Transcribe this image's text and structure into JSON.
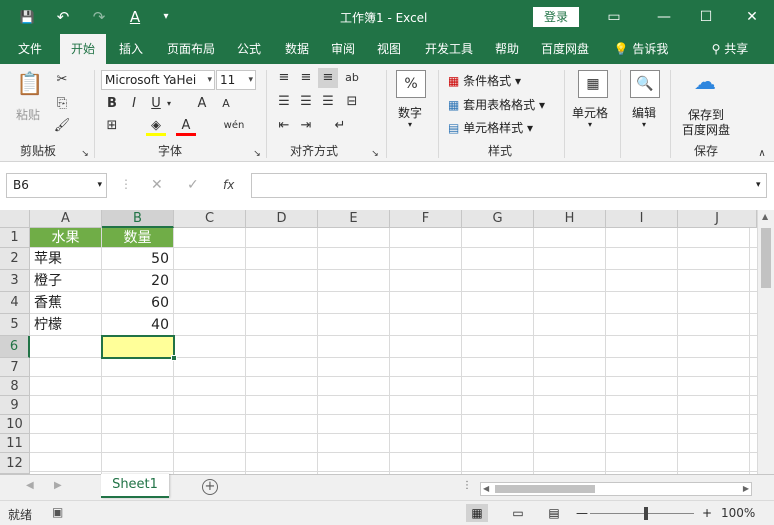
{
  "titlebar": {
    "title": "工作簿1  -  Excel",
    "login": "登录",
    "qat": {
      "save": "💾",
      "undo": "↶",
      "redo": "↷",
      "font_color": "A",
      "customize": "▾"
    },
    "controls": {
      "options": "▭",
      "minimize": "—",
      "maximize": "☐",
      "close": "✕"
    }
  },
  "tabs": [
    "文件",
    "开始",
    "插入",
    "页面布局",
    "公式",
    "数据",
    "审阅",
    "视图",
    "开发工具",
    "帮助",
    "百度网盘"
  ],
  "tell_me": "告诉我",
  "share": "共享",
  "ribbon": {
    "clipboard": {
      "label": "剪贴板",
      "paste": "粘贴"
    },
    "font": {
      "label": "字体",
      "name": "Microsoft YaHei",
      "size": "11",
      "bold": "B",
      "italic": "I",
      "underline": "U",
      "grow": "A",
      "shrink": "A",
      "phonetic": "wén"
    },
    "alignment": {
      "label": "对齐方式"
    },
    "number": {
      "label": "数字",
      "button": "数字",
      "icon": "%"
    },
    "styles": {
      "label": "样式",
      "conditional": "条件格式",
      "table": "套用表格格式",
      "cell": "单元格样式"
    },
    "cells": {
      "button": "单元格"
    },
    "editing": {
      "button": "编辑"
    },
    "save": {
      "label": "保存",
      "button_line1": "保存到",
      "button_line2": "百度网盘"
    }
  },
  "formula_bar": {
    "name_box": "B6",
    "cancel": "✕",
    "enter": "✓",
    "fx": "fx",
    "content": ""
  },
  "sheet": {
    "columns": [
      "A",
      "B",
      "C",
      "D",
      "E",
      "F",
      "G",
      "H",
      "I",
      "J"
    ],
    "rows": [
      "1",
      "2",
      "3",
      "4",
      "5",
      "6",
      "7",
      "8",
      "9",
      "10",
      "11",
      "12"
    ],
    "selected_column": "B",
    "selected_row": "6",
    "header": [
      "水果",
      "数量"
    ],
    "data": [
      [
        "苹果",
        "50"
      ],
      [
        "橙子",
        "20"
      ],
      [
        "香蕉",
        "60"
      ],
      [
        "柠檬",
        "40"
      ]
    ]
  },
  "sheet_tabs": {
    "active": "Sheet1",
    "add": "+"
  },
  "status": {
    "ready": "就绪",
    "zoom": "100%",
    "zoom_out": "—",
    "zoom_in": "+"
  },
  "colors": {
    "excel_green": "#217346",
    "header_fill": "#70ad47",
    "highlight": "#ffff99"
  }
}
